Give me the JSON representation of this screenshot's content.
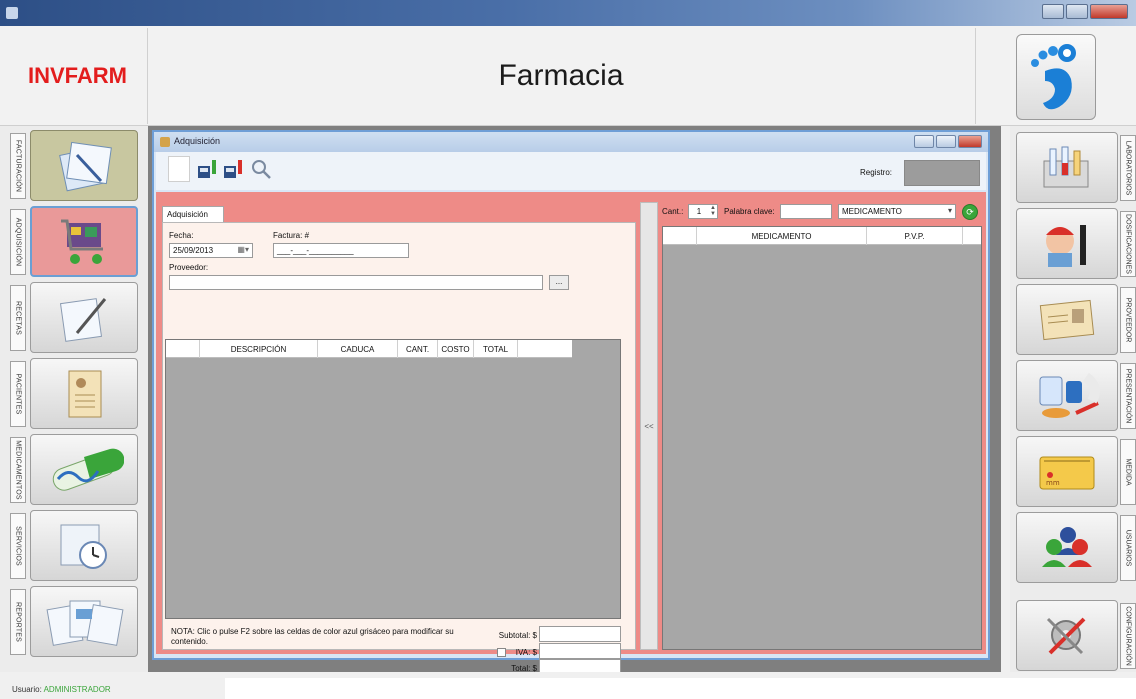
{
  "app": {
    "logo": "INVFARM",
    "title": "Farmacia",
    "help_icon": "help-footprint-icon"
  },
  "left_nav": [
    {
      "tab": "FACTURACIÓN",
      "icon": "invoice-documents-icon",
      "active": true
    },
    {
      "tab": "ADQUISICIÓN",
      "icon": "shopping-cart-icon",
      "selected": true
    },
    {
      "tab": "RECETAS",
      "icon": "prescription-pen-icon"
    },
    {
      "tab": "PACIENTES",
      "icon": "patient-record-icon"
    },
    {
      "tab": "MEDICAMENTOS",
      "icon": "medicine-capsule-icon"
    },
    {
      "tab": "SERVICIOS",
      "icon": "service-clock-icon"
    },
    {
      "tab": "REPORTES",
      "icon": "reports-icon"
    }
  ],
  "right_nav": [
    {
      "tab": "LABORATORIOS",
      "icon": "laboratory-icon"
    },
    {
      "tab": "DOSIFICACIONES",
      "icon": "dosage-character-icon"
    },
    {
      "tab": "PROVEEDOR",
      "icon": "supplier-card-icon"
    },
    {
      "tab": "PRESENTACIÓN",
      "icon": "presentation-pills-icon"
    },
    {
      "tab": "MEDIDA",
      "icon": "measure-ruler-icon"
    },
    {
      "tab": "USUARIOS",
      "icon": "users-icon"
    },
    {
      "tab": "CONFIGURACIÓN",
      "icon": "settings-tools-icon"
    }
  ],
  "window": {
    "title": "Adquisición",
    "registro_label": "Registro:",
    "tab_label": "Adquisición",
    "fecha_label": "Fecha:",
    "fecha_value": "25/09/2013",
    "factura_label": "Factura: #",
    "factura_value": "___-___-__________",
    "proveedor_label": "Proveedor:",
    "browse_label": "...",
    "grid_columns": [
      "DESCRIPCIÓN",
      "CADUCA",
      "CANT.",
      "COSTO",
      "TOTAL"
    ],
    "note": "NOTA: Clic o pulse F2 sobre las celdas de color azul grisáceo para modificar su contenido.",
    "subtotal_label": "Subtotal: $",
    "iva_label": "IVA: $",
    "total_label": "Total: $",
    "splitter_label": "<<",
    "cant_label": "Cant.:",
    "cant_value": "1",
    "keyword_label": "Palabra clave:",
    "filter_value": "MEDICAMENTO",
    "right_columns": [
      "MEDICAMENTO",
      "P.V.P."
    ]
  },
  "status": {
    "user_label": "Usuario:",
    "user_value": "ADMINISTRADOR"
  },
  "colors": {
    "logo": "#e31d1d",
    "pink_panel": "#ee8b87",
    "grid_bg": "#a7a7a7",
    "status_user": "#3aa53a"
  }
}
